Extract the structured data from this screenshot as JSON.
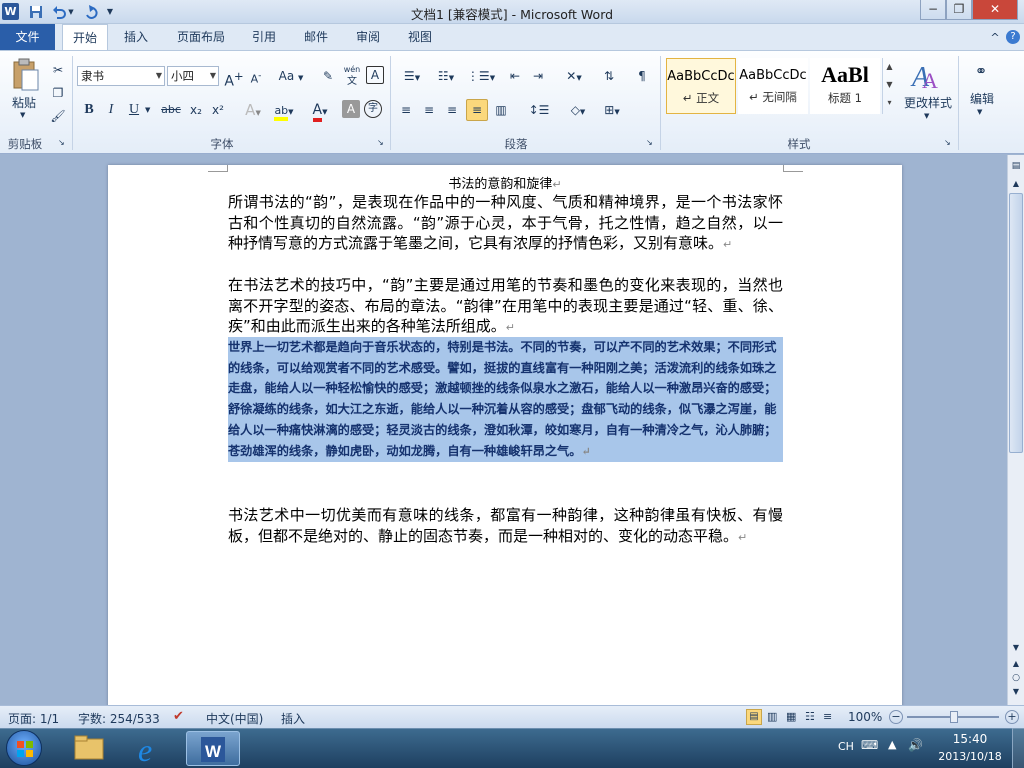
{
  "window": {
    "title": "文档1 [兼容模式] - Microsoft Word",
    "app_icon": "W"
  },
  "qat": {
    "save": "save-icon",
    "undo": "undo-icon",
    "redo": "redo-icon",
    "customize": "customize-icon"
  },
  "tabs": {
    "file": "文件",
    "home": "开始",
    "insert": "插入",
    "layout": "页面布局",
    "references": "引用",
    "mailings": "邮件",
    "review": "审阅",
    "view": "视图"
  },
  "clipboard": {
    "paste": "粘贴",
    "label": "剪贴板"
  },
  "font": {
    "name": "隶书",
    "size": "小四",
    "grow": "A",
    "shrink": "A",
    "case": "Aa",
    "bold": "B",
    "italic": "I",
    "underline": "U",
    "strike": "abc",
    "sub": "x₂",
    "sup": "x²",
    "color_a": "A",
    "label": "字体",
    "grow_sup": "+",
    "shrink_sup": "-",
    "clear_sym": "✎",
    "phonetic": "wén",
    "border_char": "A",
    "effects_char": "A",
    "highlight_char": "ab",
    "shade_char": "A",
    "enclose_char": "字"
  },
  "paragraph": {
    "label": "段落"
  },
  "styles": {
    "label": "样式",
    "items": [
      {
        "sample": "AaBbCcDc",
        "name": "↵ 正文"
      },
      {
        "sample": "AaBbCcDc",
        "name": "↵ 无间隔"
      },
      {
        "sample": "AaBl",
        "name": "标题 1"
      }
    ],
    "change": "更改样式"
  },
  "editing": {
    "label": "编辑"
  },
  "document": {
    "title": "书法的意韵和旋律",
    "paragraphs": [
      "所谓书法的“韵”，是表现在作品中的一种风度、气质和精神境界，是一个书法家怀古和个性真切的自然流露。“韵”源于心灵，本于气骨，托之性情，趋之自然，以一种抒情写意的方式流露于笔墨之间，它具有浓厚的抒情色彩，又别有意味。",
      "在书法艺术的技巧中，“韵”主要是通过用笔的节奏和墨色的变化来表现的，当然也离不开字型的姿态、布局的章法。“韵律”在用笔中的表现主要是通过“轻、重、徐、疾”和由此而派生出来的各种笔法所组成。",
      "世界上一切艺术都是趋向于音乐状态的，特别是书法。不同的节奏，可以产不同的艺术效果；不同形式的线条，可以给观赏者不同的艺术感受。譬如，挺拔的直线富有一种阳刚之美；活泼流利的线条如珠之走盘，能给人以一种轻松愉快的感受；激越顿挫的线条似泉水之激石，能给人以一种激昂兴奋的感受；舒徐凝练的线条，如大江之东逝，能给人以一种沉着从容的感受；盘郁飞动的线条，似飞瀑之泻崖，能给人以一种痛快淋漓的感受；轻灵淡古的线条，澄如秋潭，皎如寒月，自有一种清冷之气，沁人肺腑；苍劲雄浑的线条，静如虎卧，动如龙腾，自有一种雄峻轩昂之气。",
      "书法艺术中一切优美而有意味的线条，都富有一种韵律，这种韵律虽有快板、有慢板，但都不是绝对的、静止的固态节奏，而是一种相对的、变化的动态平稳。"
    ]
  },
  "status": {
    "page": "页面: 1/1",
    "words": "字数: 254/533",
    "lang": "中文(中国)",
    "mode": "插入",
    "zoom": "100%"
  },
  "taskbar": {
    "ime": "CH",
    "time": "15:40",
    "date": "2013/10/18"
  },
  "misc": {
    "minimize": "−",
    "restore": "❐",
    "close": "✕",
    "help": "?",
    "collapse": "^",
    "plus": "+",
    "minus": "−"
  }
}
